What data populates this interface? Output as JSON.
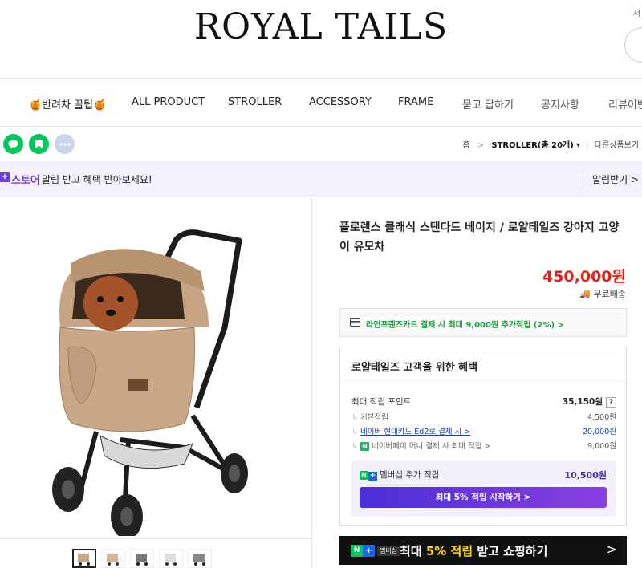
{
  "header": {
    "logo": "ROYAL TAILS",
    "top_right": "서"
  },
  "nav": {
    "items": [
      {
        "label": "🍯반려차 꿀팁🍯"
      },
      {
        "label": "ALL PRODUCT"
      },
      {
        "label": "STROLLER"
      },
      {
        "label": "ACCESSORY"
      },
      {
        "label": "FRAME"
      },
      {
        "label": "묻고 답하기"
      },
      {
        "label": "공지사항"
      },
      {
        "label": "리뷰이벤"
      }
    ]
  },
  "breadcrumb": {
    "home": "홈",
    "sep": ">",
    "category": "STROLLER(총 20개)",
    "others": "다른상품보기"
  },
  "notice": {
    "store_label": "스토어",
    "text": "알림 받고 혜택 받아보세요!",
    "button": "알림받기 >"
  },
  "product": {
    "title": "플로렌스 클래식 스탠다드 베이지 / 로얄테일즈 강아지 고양이 유모차",
    "price": "450,000원",
    "shipping": "무료배송",
    "card_offer": "라인프렌즈카드 결제 시 최대 9,000원 추가적립 (2%) >"
  },
  "benefits": {
    "title": "로얄테일즈 고객을 위한 혜택",
    "max_label": "최대 적립 포인트",
    "max_value": "35,150원",
    "qmark": "?",
    "rows": [
      {
        "label": "기본적립",
        "value": "4,500원"
      },
      {
        "label": "네이버 현대카드 Ed2로 결제 시 >",
        "value": "20,000원"
      },
      {
        "label": "네이버페이 머니 결제 시 최대 적립 >",
        "value": "9,000원"
      }
    ],
    "member_label": "멤버십 추가 적립",
    "member_value": "10,500원",
    "member_button": "최대 5% 적립 시작하기 >"
  },
  "banner": {
    "badge": "멤버십",
    "text_a": "최대 ",
    "text_b": "5% 적립",
    "text_c": " 받고 쇼핑하기",
    "chev": ">"
  },
  "colors": {
    "price": "#e2231a",
    "naver_green": "#03c75a",
    "store_purple": "#6b3fd4",
    "notice_bg": "#f4f1fb"
  }
}
